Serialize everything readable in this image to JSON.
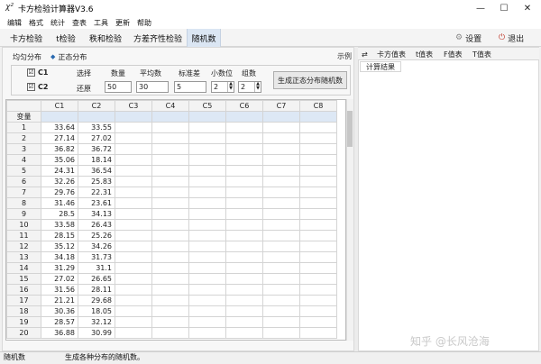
{
  "window": {
    "icon_glyph": "χ²",
    "title": "卡方检验计算器V3.6",
    "minimize": "—",
    "maximize": "☐",
    "close": "✕"
  },
  "menu": [
    "编辑",
    "格式",
    "统计",
    "查表",
    "工具",
    "更新",
    "帮助"
  ],
  "tabs": [
    "卡方检验",
    "t检验",
    "秩和检验",
    "方差齐性检验",
    "随机数"
  ],
  "active_tab": "随机数",
  "header_actions": {
    "settings": "设置",
    "settings_icon": "⚙",
    "exit": "退出",
    "exit_icon": "⏻"
  },
  "subtabs": {
    "uniform": "均匀分布",
    "normal": "正态分布",
    "normal_marker": "◆",
    "example": "示例"
  },
  "settings": {
    "c1_label": "C1",
    "c2_label": "C2",
    "c1_checked": "☑",
    "c2_checked": "☑",
    "select_label": "选择",
    "restore_label": "还原",
    "count_label": "数量",
    "count_value": "50",
    "mean_label": "平均数",
    "mean_value": "30",
    "sd_label": "标准差",
    "sd_value": "5",
    "decimals_label": "小数位",
    "decimals_value": "2",
    "groups_label": "组数",
    "groups_value": "2",
    "generate_button": "生成正态分布随机数"
  },
  "grid": {
    "columns": [
      "C1",
      "C2",
      "C3",
      "C4",
      "C5",
      "C6",
      "C7",
      "C8"
    ],
    "var_label": "变量",
    "rows": [
      [
        "1",
        "33.64",
        "33.55"
      ],
      [
        "2",
        "27.14",
        "27.02"
      ],
      [
        "3",
        "36.82",
        "36.72"
      ],
      [
        "4",
        "35.06",
        "18.14"
      ],
      [
        "5",
        "24.31",
        "36.54"
      ],
      [
        "6",
        "32.26",
        "25.83"
      ],
      [
        "7",
        "29.76",
        "22.31"
      ],
      [
        "8",
        "31.46",
        "23.61"
      ],
      [
        "9",
        "28.5",
        "34.13"
      ],
      [
        "10",
        "33.58",
        "26.43"
      ],
      [
        "11",
        "28.15",
        "25.26"
      ],
      [
        "12",
        "35.12",
        "34.26"
      ],
      [
        "13",
        "34.18",
        "31.73"
      ],
      [
        "14",
        "31.29",
        "31.1"
      ],
      [
        "15",
        "27.02",
        "26.65"
      ],
      [
        "16",
        "31.56",
        "28.11"
      ],
      [
        "17",
        "21.21",
        "29.68"
      ],
      [
        "18",
        "30.36",
        "18.05"
      ],
      [
        "19",
        "28.57",
        "32.12"
      ],
      [
        "20",
        "36.88",
        "30.99"
      ]
    ]
  },
  "right": {
    "swap_icon": "⇄",
    "tabs": [
      "卡方值表",
      "t值表",
      "F值表",
      "T值表"
    ],
    "result_label": "计算结果"
  },
  "watermark": "知乎 @长风沧海",
  "status": {
    "left": "随机数",
    "message": "生成各种分布的随机数。"
  }
}
